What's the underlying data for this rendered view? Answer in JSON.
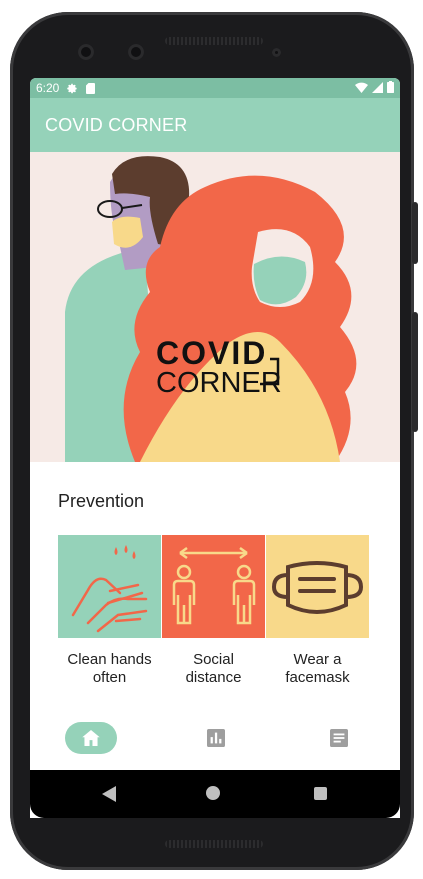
{
  "status_bar": {
    "time": "6:20",
    "icons": [
      "settings-icon",
      "sim-card-icon",
      "wifi-icon",
      "signal-icon",
      "battery-icon"
    ]
  },
  "app_bar": {
    "title": "COVID CORNER"
  },
  "hero": {
    "logo_line1": "COVID",
    "logo_line2": "CORNER"
  },
  "prevention": {
    "title": "Prevention",
    "items": [
      {
        "label_line1": "Clean hands",
        "label_line2": "often",
        "icon": "hand-washing-icon",
        "color": "#95d2b9"
      },
      {
        "label_line1": "Social",
        "label_line2": "distance",
        "icon": "social-distance-icon",
        "color": "#f26749"
      },
      {
        "label_line1": "Wear a",
        "label_line2": "facemask",
        "icon": "facemask-icon",
        "color": "#f8d98a"
      }
    ]
  },
  "bottom_nav": {
    "items": [
      "home-icon",
      "stats-icon",
      "news-icon"
    ],
    "active": "home-icon"
  },
  "colors": {
    "accent": "#95d2b9",
    "status_bar": "#7cbea3",
    "red": "#f26749",
    "yellow": "#f8d98a"
  }
}
